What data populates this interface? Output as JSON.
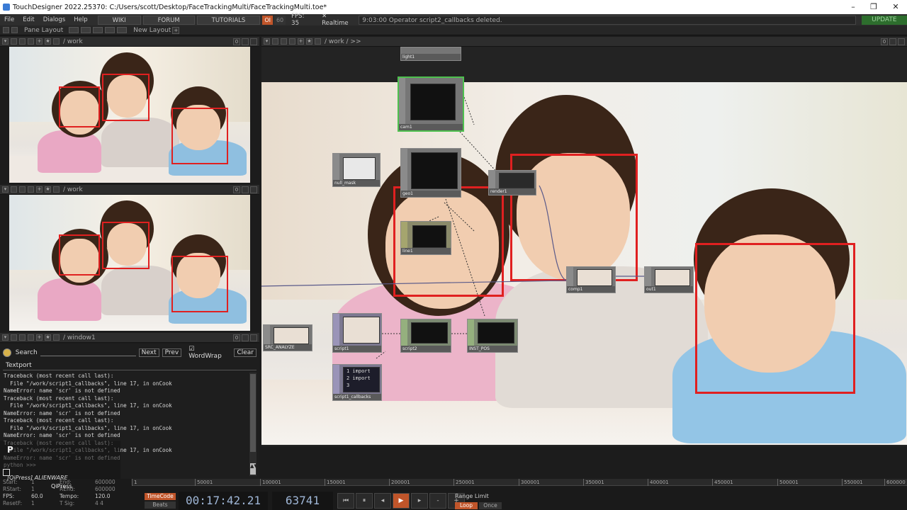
{
  "window": {
    "title": "TouchDesigner 2022.25370: C:/Users/scott/Desktop/FaceTrackingMulti/FaceTrackingMulti.toe*",
    "controls": [
      "–",
      "❐",
      "✕"
    ]
  },
  "menu": {
    "items": [
      "File",
      "Edit",
      "Dialogs",
      "Help"
    ],
    "buttons": [
      "WIKI",
      "FORUM",
      "TUTORIALS"
    ],
    "oi": "OI",
    "fps_cap": "60",
    "fps_label": "FPS: 35",
    "realtime": "Realtime",
    "status": "9:03:00 Operator script2_callbacks deleted.",
    "update": "UPDATE"
  },
  "layout": {
    "pane_layout": "Pane Layout",
    "new_layout": "New Layout",
    "plus": "+"
  },
  "panes": {
    "top_left": {
      "path": "/ work",
      "index": "0"
    },
    "mid_left": {
      "path": "/ work",
      "index": "0"
    },
    "textport_pane": {
      "path": "/ window1",
      "index": "0"
    },
    "network": {
      "path": "/ work / >>",
      "index": "0"
    }
  },
  "textport": {
    "search_label": "Search",
    "next": "Next",
    "prev": "Prev",
    "wordwrap": "WordWrap",
    "clear": "Clear",
    "tab": "Textport",
    "lines": [
      "Traceback (most recent call last):",
      "  File \"/work/script1_callbacks\", line 17, in onCook",
      "NameError: name 'scr' is not defined",
      "Traceback (most recent call last):",
      "  File \"/work/script1_callbacks\", line 17, in onCook",
      "NameError: name 'scr' is not defined",
      "Traceback (most recent call last):",
      "  File \"/work/script1_callbacks\", line 17, in onCook",
      "NameError: name 'scr' is not defined",
      "Traceback (most recent call last):",
      "  File \"/work/script1_callbacks\", line 17, in onCook",
      "NameError: name 'scr' is not defined",
      "python >>>"
    ]
  },
  "overlay": {
    "qipress": "[QiPress] ALIENWARE",
    "p": "P",
    "brand": "QiPress"
  },
  "nodes": [
    "light1",
    "cam1",
    "null_mask",
    "geo1",
    "render1",
    "line1",
    "comp1",
    "out1",
    "SRC_ANALYZE",
    "script1",
    "script2",
    "INST_POS",
    "script1_callbacks"
  ],
  "dat_code": [
    "1  import",
    "2  import",
    "3"
  ],
  "timeline": {
    "ticks": [
      "1",
      "50001",
      "100001",
      "150001",
      "200001",
      "250001",
      "300001",
      "350001",
      "400001",
      "450001",
      "500001",
      "550001",
      "600000"
    ],
    "stats": [
      [
        "Start:",
        "1",
        "End:",
        "600000"
      ],
      [
        "RStart:",
        "1",
        "REnd:",
        "600000"
      ],
      [
        "FPS:",
        "60.0",
        "Tempo:",
        "120.0"
      ],
      [
        "ResetF:",
        "1",
        "T Sig:",
        "4   4"
      ]
    ],
    "timecode_label": "TimeCode",
    "beats_label": "Beats",
    "timecode": "00:17:42.21",
    "frame": "63741",
    "range_limit": "Range Limit",
    "loop": "Loop",
    "once": "Once"
  }
}
